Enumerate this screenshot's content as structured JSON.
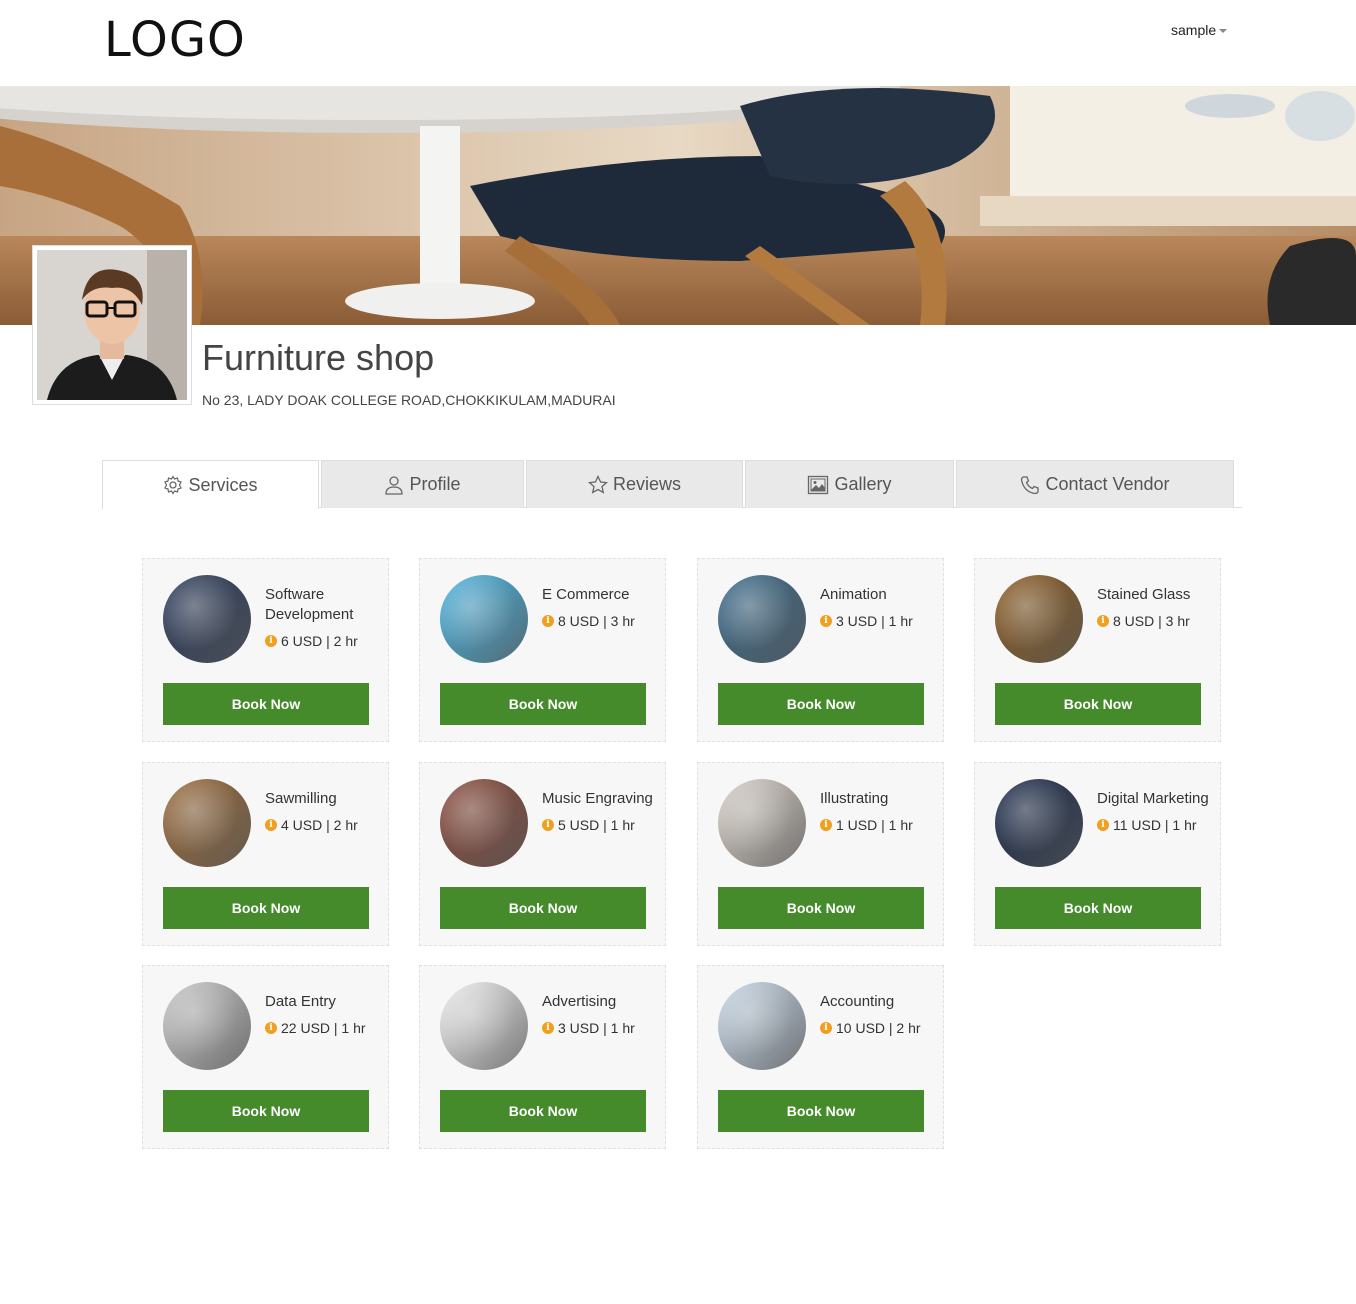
{
  "header": {
    "logo": "LOGO",
    "user_menu": "sample"
  },
  "shop": {
    "title": "Furniture shop",
    "address": "No 23, LADY DOAK COLLEGE ROAD,CHOKKIKULAM,MADURAI"
  },
  "tabs": [
    {
      "label": "Services",
      "icon": "gear-icon",
      "active": true
    },
    {
      "label": "Profile",
      "icon": "user-icon",
      "active": false
    },
    {
      "label": "Reviews",
      "icon": "star-icon",
      "active": false
    },
    {
      "label": "Gallery",
      "icon": "image-icon",
      "active": false
    },
    {
      "label": "Contact Vendor",
      "icon": "phone-icon",
      "active": false
    }
  ],
  "book_label": "Book Now",
  "services": [
    {
      "name": "Software Development",
      "price": "6 USD | 2 hr",
      "thumb_color": "#2a3a5a"
    },
    {
      "name": "E Commerce",
      "price": "8 USD | 3 hr",
      "thumb_color": "#4ab3e0"
    },
    {
      "name": "Animation",
      "price": "3 USD | 1 hr",
      "thumb_color": "#3a6a8a"
    },
    {
      "name": "Stained Glass",
      "price": "8 USD | 3 hr",
      "thumb_color": "#8a5a20"
    },
    {
      "name": "Sawmilling",
      "price": "4 USD | 2 hr",
      "thumb_color": "#9a6a3a"
    },
    {
      "name": "Music Engraving",
      "price": "5 USD | 1 hr",
      "thumb_color": "#8a4a3a"
    },
    {
      "name": "Illustrating",
      "price": "1 USD | 1 hr",
      "thumb_color": "#d8d0c8"
    },
    {
      "name": "Digital Marketing",
      "price": "11 USD | 1 hr",
      "thumb_color": "#1a2a4a"
    },
    {
      "name": "Data Entry",
      "price": "22 USD | 1 hr",
      "thumb_color": "#c8c8c8"
    },
    {
      "name": "Advertising",
      "price": "3 USD | 1 hr",
      "thumb_color": "#eeeeee"
    },
    {
      "name": "Accounting",
      "price": "10 USD | 2 hr",
      "thumb_color": "#c8d8e8"
    }
  ]
}
